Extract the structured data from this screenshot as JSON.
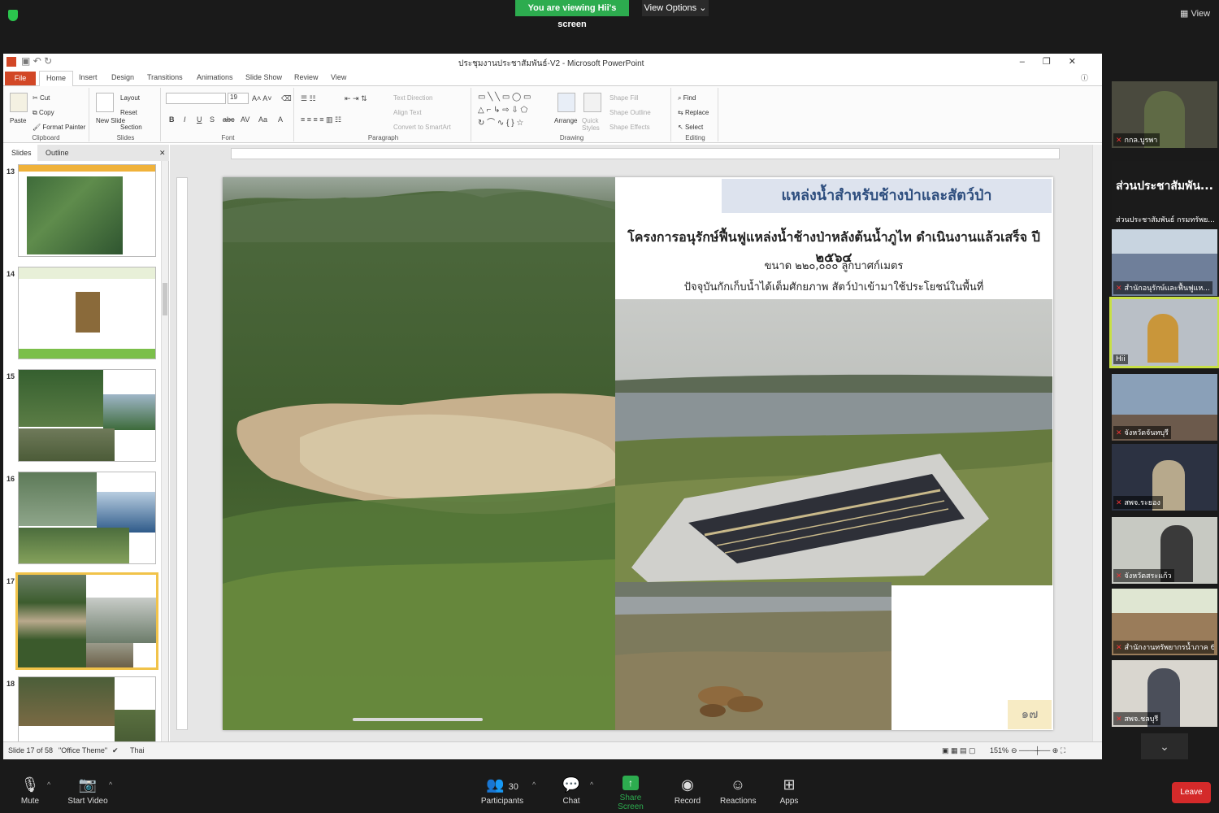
{
  "zoom": {
    "viewing_banner": "You are viewing Hii's screen",
    "view_options": "View Options",
    "view_button": "View",
    "toolbar": {
      "mute": "Mute",
      "start_video": "Start Video",
      "participants": "Participants",
      "participants_count": "30",
      "chat": "Chat",
      "share_screen": "Share Screen",
      "record": "Record",
      "reactions": "Reactions",
      "apps": "Apps",
      "leave": "Leave"
    },
    "gallery": [
      {
        "name": "กกล.บูรพา"
      },
      {
        "name": "ส่วนประชาสัมพันธ์ กรมทรัพย...",
        "big": "ส่วนประชาสัมพัน..."
      },
      {
        "name": "สำนักอนุรักษ์และฟื้นฟูแห..."
      },
      {
        "name": "Hii"
      },
      {
        "name": "จังหวัดจันทบุรี"
      },
      {
        "name": "สพจ.ระยอง"
      },
      {
        "name": "จังหวัดสระแก้ว"
      },
      {
        "name": "สำนักงานทรัพยากรน้ำภาค 6"
      },
      {
        "name": "สพจ.ชลบุรี"
      }
    ]
  },
  "ppt": {
    "window_title": "ประชุมงานประชาสัมพันธ์-V2 - Microsoft PowerPoint",
    "tabs": [
      "File",
      "Home",
      "Insert",
      "Design",
      "Transitions",
      "Animations",
      "Slide Show",
      "Review",
      "View"
    ],
    "ribbon": {
      "paste": "Paste",
      "cut": "Cut",
      "copy": "Copy",
      "format_painter": "Format Painter",
      "clipboard": "Clipboard",
      "new_slide": "New Slide",
      "layout": "Layout",
      "reset": "Reset",
      "section": "Section",
      "slides": "Slides",
      "font_size": "19",
      "font": "Font",
      "text_direction": "Text Direction",
      "align_text": "Align Text",
      "convert_smartart": "Convert to SmartArt",
      "paragraph": "Paragraph",
      "arrange": "Arrange",
      "quick_styles": "Quick Styles",
      "shape_fill": "Shape Fill",
      "shape_outline": "Shape Outline",
      "shape_effects": "Shape Effects",
      "drawing": "Drawing",
      "find": "Find",
      "replace": "Replace",
      "select": "Select",
      "editing": "Editing"
    },
    "pane_tabs": [
      "Slides",
      "Outline"
    ],
    "thumbnails": [
      {
        "num": "13"
      },
      {
        "num": "14"
      },
      {
        "num": "15"
      },
      {
        "num": "16"
      },
      {
        "num": "17"
      },
      {
        "num": "18"
      }
    ],
    "slide": {
      "title": "แหล่งน้ำสำหรับช้างป่าและสัตว์ป่า",
      "heading": "โครงการอนุรักษ์ฟื้นฟูแหล่งน้ำช้างป่าหลังต้นน้ำภูไท ดำเนินงานแล้วเสร็จ ปี ๒๕๖๔",
      "line1": "ขนาด ๒๒๐,๐๐๐ ลูกบาศก์เมตร",
      "line2": "ปัจจุบันกักเก็บน้ำได้เต็มศักยภาพ สัตว์ป่าเข้ามาใช้ประโยชน์ในพื้นที่",
      "page_number": "๑๗"
    },
    "status": {
      "slide_of": "Slide 17 of 58",
      "theme": "\"Office Theme\"",
      "language": "Thai",
      "zoom": "151%"
    }
  }
}
